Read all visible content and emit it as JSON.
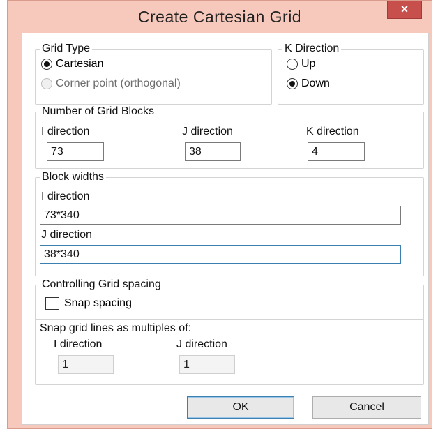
{
  "dialog": {
    "title": "Create Cartesian Grid",
    "close_icon": "×"
  },
  "grid_type": {
    "label": "Grid Type",
    "options": [
      {
        "label": "Cartesian",
        "checked": true,
        "enabled": true
      },
      {
        "label": "Corner point (orthogonal)",
        "checked": false,
        "enabled": false
      }
    ]
  },
  "k_direction": {
    "label": "K Direction",
    "options": [
      {
        "label": "Up",
        "checked": false
      },
      {
        "label": "Down",
        "checked": true
      }
    ]
  },
  "grid_blocks": {
    "label": "Number of Grid Blocks",
    "i_label": "I direction",
    "i_value": "73",
    "j_label": "J direction",
    "j_value": "38",
    "k_label": "K direction",
    "k_value": "4"
  },
  "block_widths": {
    "label": "Block widths",
    "i_label": "I direction",
    "i_value": "73*340",
    "j_label": "J direction",
    "j_value": "38*340"
  },
  "grid_spacing": {
    "label": "Controlling Grid spacing",
    "snap_label": "Snap spacing",
    "snap_checked": false,
    "multiples_label": "Snap grid lines as multiples of:",
    "i_label": "I direction",
    "i_value": "1",
    "j_label": "J direction",
    "j_value": "1"
  },
  "buttons": {
    "ok": "OK",
    "cancel": "Cancel"
  },
  "colors": {
    "titlebar": "#f7c9bd",
    "close_button": "#c7504c",
    "focus_border": "#3c7fb1"
  }
}
